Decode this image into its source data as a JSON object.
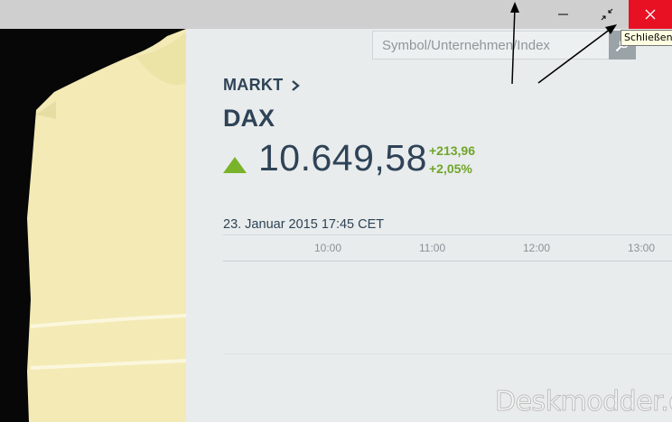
{
  "window": {
    "tooltip": "Schließen",
    "controls": [
      "minimize-icon",
      "restore-icon",
      "close-icon"
    ]
  },
  "search": {
    "placeholder": "Symbol/Unternehmen/Index",
    "icon": "search-icon"
  },
  "breadcrumb": {
    "label": "MARKT",
    "icon": "chevron-right-icon"
  },
  "index": {
    "name": "DAX",
    "price": "10.649,58",
    "trend_icon": "triangle-up-icon",
    "change_abs": "+213,96",
    "change_pct": "+2,05%"
  },
  "chart": {
    "date_label": "23. Januar 2015 17:45 CET",
    "ticks": [
      "10:00",
      "11:00",
      "12:00",
      "13:00"
    ]
  },
  "watermark": "Deskmodder.de",
  "colors": {
    "close_red": "#e81123",
    "up_green": "#78b32a",
    "text_dark": "#2e4357"
  }
}
